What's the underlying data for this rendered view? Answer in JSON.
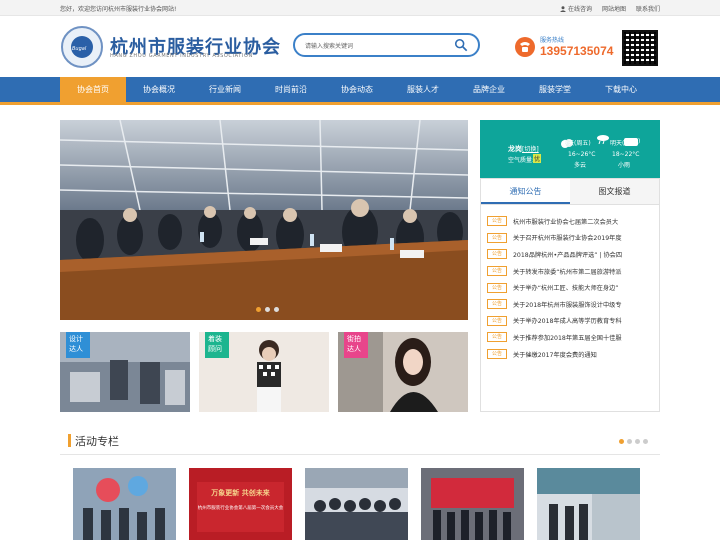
{
  "topbar": {
    "welcome": "您好，欢迎您访问杭州市服装行业协会网站!",
    "online": "在线咨询",
    "sitemap": "网站地图",
    "contact": "联系我们"
  },
  "header": {
    "logo_text": "Bugal",
    "title": "杭州市服装行业协会",
    "subtitle": "HANG ZHOU GARMENT INDUSTRY ASSOCIATION",
    "search_placeholder": "请输入搜索关键词",
    "hotline_label": "服务热线",
    "hotline_number": "13957135074"
  },
  "nav": [
    "协会首页",
    "协会概况",
    "行业新闻",
    "时尚前沿",
    "协会动态",
    "服装人才",
    "品牌企业",
    "服装学堂",
    "下载中心"
  ],
  "weather": {
    "city": "龙岗",
    "switch": "[切换]",
    "air_label": "空气质量:",
    "air_value": "优",
    "today_label": "今天(周五)",
    "today_temp": "16~26°C",
    "today_desc": "多云",
    "tomorrow_label": "明天(",
    "tomorrow_close": ")",
    "tomorrow_temp": "18~22°C",
    "tomorrow_desc": "小雨"
  },
  "tabs": [
    "通知公告",
    "图文报道"
  ],
  "notices": [
    {
      "tag": "公告",
      "text": "杭州市服装行业协会七届第二次会员大"
    },
    {
      "tag": "公告",
      "text": "关于召开杭州市服装行业协会2019年度"
    },
    {
      "tag": "公告",
      "text": "2018品牌杭州•产品品牌评选” | 协会四"
    },
    {
      "tag": "公告",
      "text": "关于转发市旅委“杭州市第二届旅游特派"
    },
    {
      "tag": "公告",
      "text": "关于举办“杭州工匠、技能大师在身边”"
    },
    {
      "tag": "公告",
      "text": "关于2018年杭州市服装服饰设计中级专"
    },
    {
      "tag": "公告",
      "text": "关于举办2018年成人高等学历教育专科"
    },
    {
      "tag": "公告",
      "text": "关于推荐参加2018年第五届全国十佳服"
    },
    {
      "tag": "公告",
      "text": "关于催缴2017年度会费的通知"
    }
  ],
  "tiles": [
    {
      "label": "设计达人",
      "color": "#2f8fd6"
    },
    {
      "label": "着装顾问",
      "color": "#1db58f"
    },
    {
      "label": "街拍达人",
      "color": "#e8458b"
    }
  ],
  "section": {
    "title": "活动专栏"
  },
  "gallery_captions": [
    "万象更新 共创未来",
    "杭州市服装行业协会第八届第一次会员大会"
  ],
  "colors": {
    "brand_blue": "#2f6db3",
    "accent_orange": "#f0a030",
    "weather_teal": "#0ea59a"
  }
}
